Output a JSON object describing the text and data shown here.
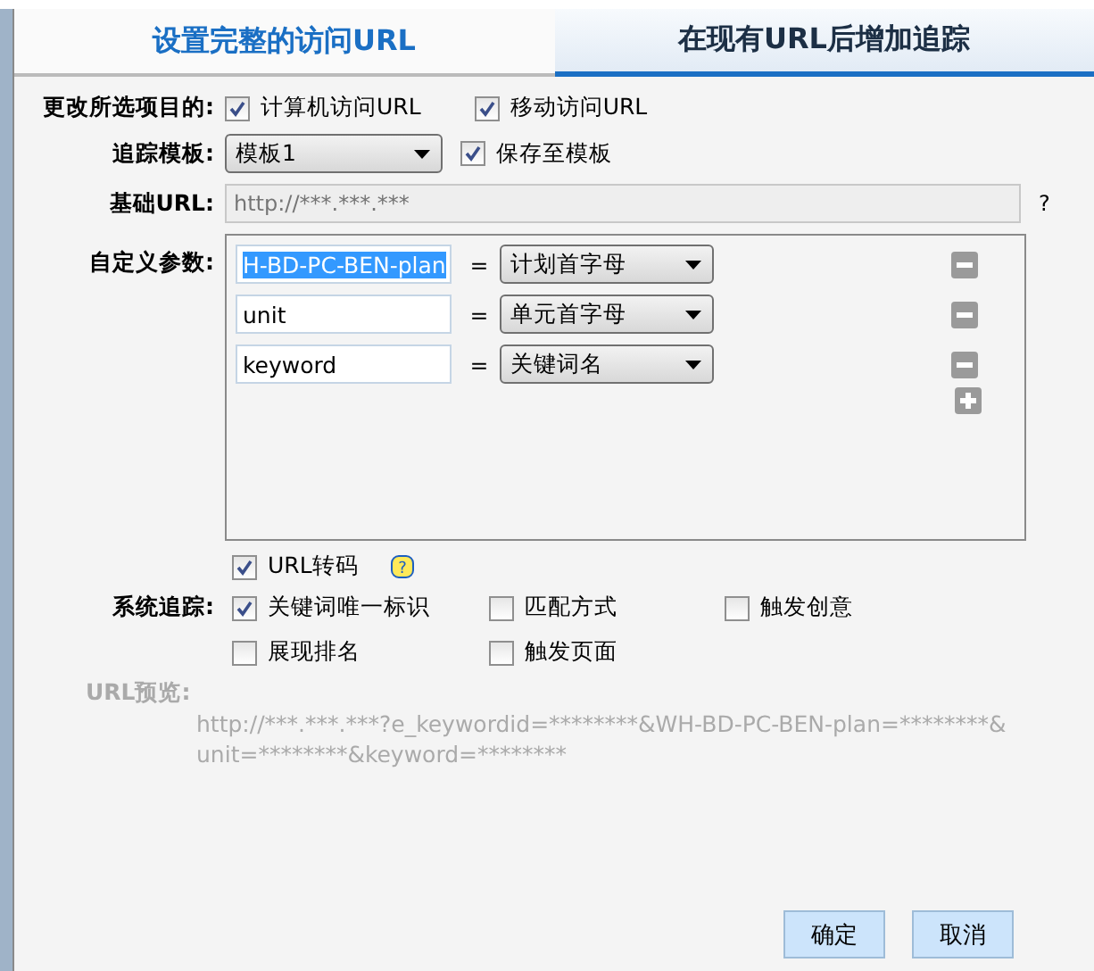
{
  "tabs": [
    {
      "label": "设置完整的访问URL",
      "selected": true
    },
    {
      "label": "在现有URL后增加追踪",
      "selected": false
    }
  ],
  "targets": {
    "label": "更改所选项目的:",
    "options": [
      {
        "label": "计算机访问URL",
        "checked": true
      },
      {
        "label": "移动访问URL",
        "checked": true
      }
    ]
  },
  "template": {
    "label": "追踪模板:",
    "value": "模板1",
    "save": {
      "label": "保存至模板",
      "checked": true
    }
  },
  "base_url": {
    "label": "基础URL:",
    "placeholder": "http://***.***.***",
    "help": "?"
  },
  "params": {
    "label": "自定义参数:",
    "rows": [
      {
        "name": "H-BD-PC-BEN-plan",
        "text_selected": true,
        "eq": "=",
        "value": "计划首字母"
      },
      {
        "name": "unit",
        "text_selected": false,
        "eq": "=",
        "value": "单元首字母"
      },
      {
        "name": "keyword",
        "text_selected": false,
        "eq": "=",
        "value": "关键词名"
      }
    ]
  },
  "url_encode": {
    "label": "URL转码",
    "checked": true,
    "help": "?"
  },
  "system_tracking": {
    "label": "系统追踪:",
    "options": [
      {
        "label": "关键词唯一标识",
        "checked": true
      },
      {
        "label": "匹配方式",
        "checked": false
      },
      {
        "label": "触发创意",
        "checked": false
      },
      {
        "label": "展现排名",
        "checked": false
      },
      {
        "label": "触发页面",
        "checked": false
      }
    ]
  },
  "preview": {
    "label": "URL预览:",
    "text": "http://***.***.***?e_keywordid=********&WH-BD-PC-BEN-plan=********&unit=********&keyword=********"
  },
  "buttons": [
    "确定",
    "取消"
  ]
}
